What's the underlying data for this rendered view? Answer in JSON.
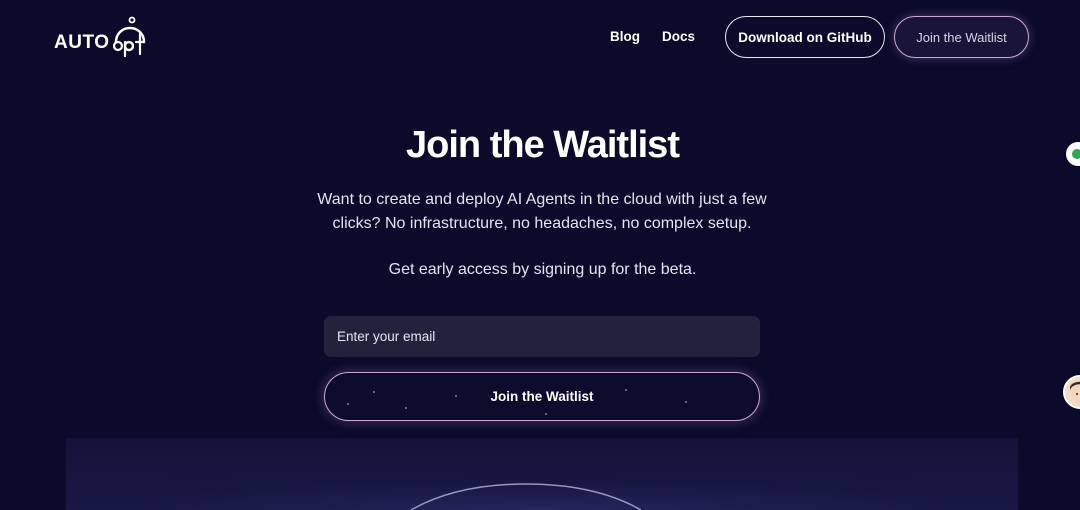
{
  "header": {
    "logo_text": "AUTOgpt",
    "nav": {
      "blog": "Blog",
      "docs": "Docs"
    },
    "github_button": "Download on GitHub",
    "waitlist_button": "Join the Waitlist"
  },
  "hero": {
    "title": "Join the Waitlist",
    "description": "Want to create and deploy AI Agents in the cloud with just a few clicks? No infrastructure, no headaches, no complex setup.",
    "subtitle": "Get early access by signing up for the beta.",
    "email_placeholder": "Enter your email",
    "email_value": "",
    "submit_button": "Join the Waitlist"
  },
  "colors": {
    "background": "#0b0a2a",
    "input_bg": "#22223d",
    "accent_border": "#c9a8d8"
  }
}
